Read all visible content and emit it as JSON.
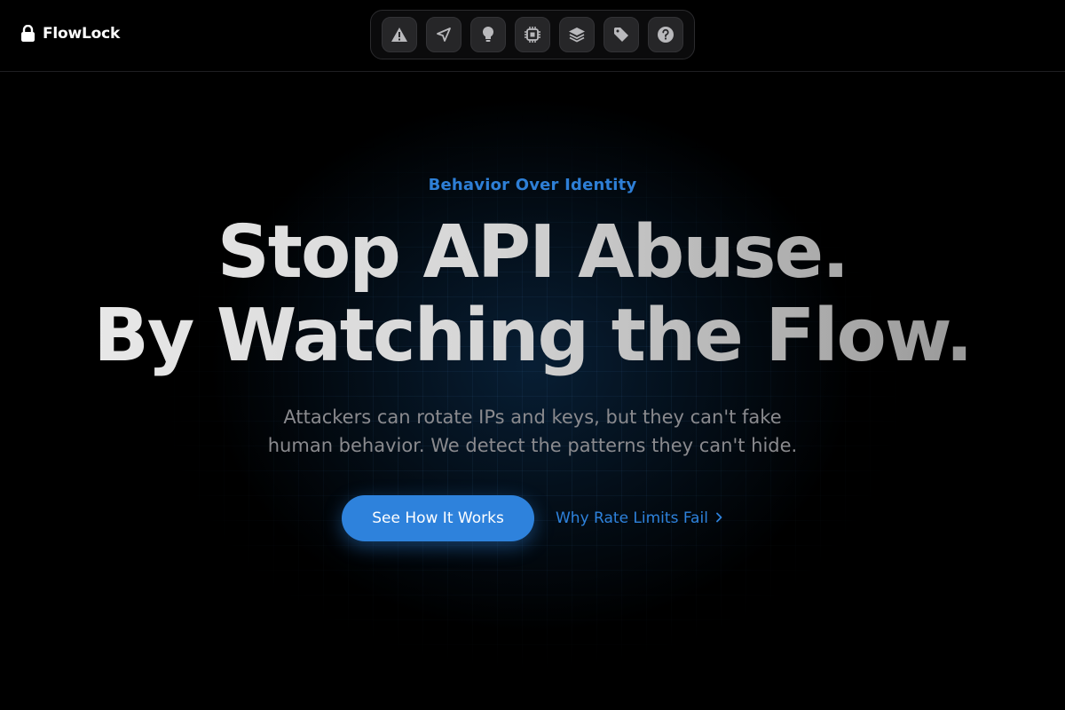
{
  "brand": {
    "name": "FlowLock",
    "icon": "lock-icon"
  },
  "iconbar": {
    "items": [
      {
        "icon": "warning-icon"
      },
      {
        "icon": "send-icon"
      },
      {
        "icon": "lightbulb-icon"
      },
      {
        "icon": "chip-icon"
      },
      {
        "icon": "layers-icon"
      },
      {
        "icon": "tag-icon"
      },
      {
        "icon": "help-icon"
      }
    ]
  },
  "hero": {
    "eyebrow": "Behavior Over Identity",
    "headline_line1": "Stop API Abuse.",
    "headline_line2": "By Watching the Flow.",
    "subtitle_line1": "Attackers can rotate IPs and keys, but they can't fake",
    "subtitle_line2": "human behavior. We detect the patterns they can't hide.",
    "cta_primary": "See How It Works",
    "cta_secondary": "Why Rate Limits Fail"
  },
  "colors": {
    "accent": "#2e82dc",
    "background": "#000000"
  }
}
